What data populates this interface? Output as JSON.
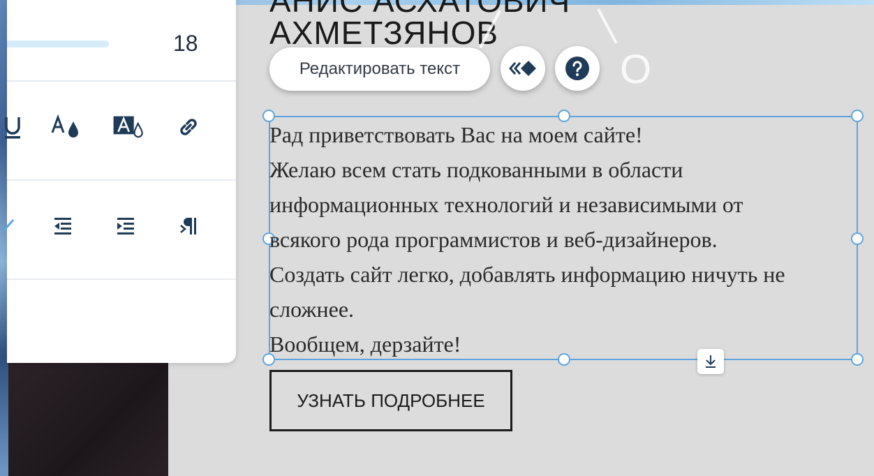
{
  "panel": {
    "font_size_value": "18"
  },
  "heading": {
    "line1": "АНИС АСХАТОВИЧ",
    "line2": "АХМЕТЗЯНОВ",
    "letter": "О"
  },
  "toolbar": {
    "edit_text_label": "Редактировать текст"
  },
  "text_block": {
    "lines": [
      "Рад приветствовать Вас на моем сайте!",
      "Желаю всем стать подкованными в области",
      "информационных технологий и независимыми от",
      "всякого рода программистов и веб-дизайнеров.",
      "Создать сайт легко, добавлять информацию ничуть не",
      "сложнее.",
      "Вообщем, дерзайте!"
    ]
  },
  "cta": {
    "label": "УЗНАТЬ ПОДРОБНЕЕ"
  },
  "colors": {
    "accent": "#5fa4dd",
    "canvas": "#dcdcdc",
    "icon": "#1f3b57"
  },
  "icons": {
    "row1": [
      "underline-icon",
      "text-color-icon",
      "text-highlight-icon",
      "link-icon"
    ],
    "row2": [
      "align-icon",
      "decrease-indent-icon",
      "increase-indent-icon",
      "rtl-paragraph-icon"
    ]
  }
}
